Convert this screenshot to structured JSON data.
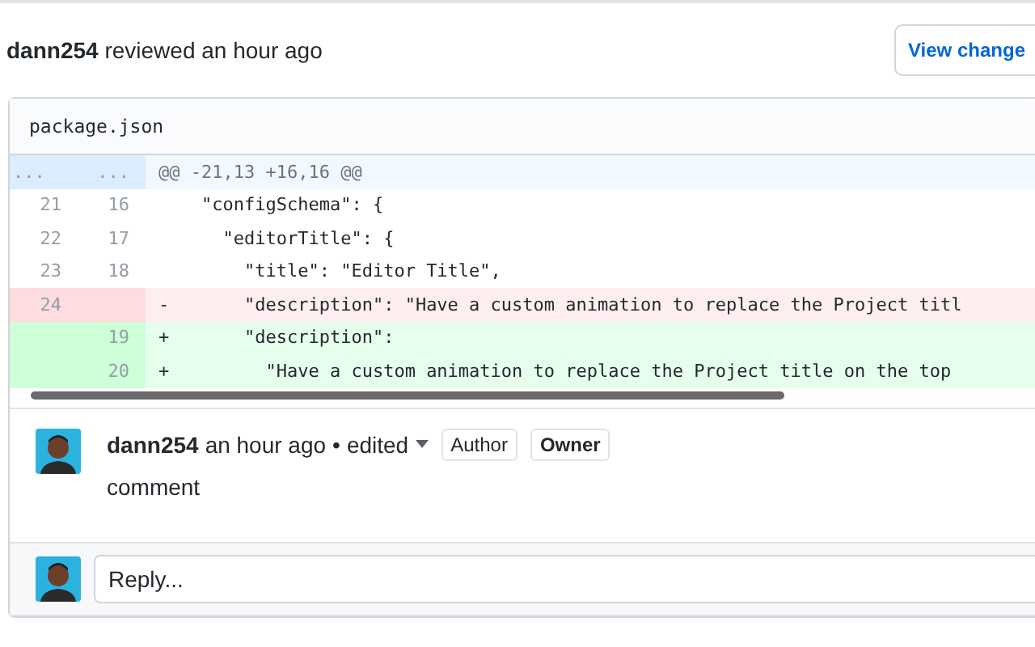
{
  "review": {
    "author": "dann254",
    "action": "reviewed an hour ago",
    "view_button": "View change"
  },
  "file": {
    "name": "package.json",
    "hunk": {
      "old_marker": "...",
      "new_marker": "...",
      "header": "@@ -21,13 +16,16 @@"
    },
    "lines": [
      {
        "kind": "context",
        "old": "21",
        "new": "16",
        "code": "  \"configSchema\": {"
      },
      {
        "kind": "context",
        "old": "22",
        "new": "17",
        "code": "    \"editorTitle\": {"
      },
      {
        "kind": "context",
        "old": "23",
        "new": "18",
        "code": "      \"title\": \"Editor Title\","
      },
      {
        "kind": "deletion",
        "old": "24",
        "sign": "-",
        "code": "      \"description\": \"Have a custom animation to replace the Project titl"
      },
      {
        "kind": "addition",
        "new": "19",
        "sign": "+",
        "code": "      \"description\":"
      },
      {
        "kind": "addition",
        "new": "20",
        "sign": "+",
        "code": "        \"Have a custom animation to replace the Project title on the top"
      }
    ]
  },
  "comment": {
    "author": "dann254",
    "time": "an hour ago",
    "separator": "•",
    "edited": "edited",
    "badges": [
      {
        "label": "Author",
        "bold": false
      },
      {
        "label": "Owner",
        "bold": true
      }
    ],
    "body": "comment"
  },
  "reply": {
    "placeholder": "Reply..."
  }
}
